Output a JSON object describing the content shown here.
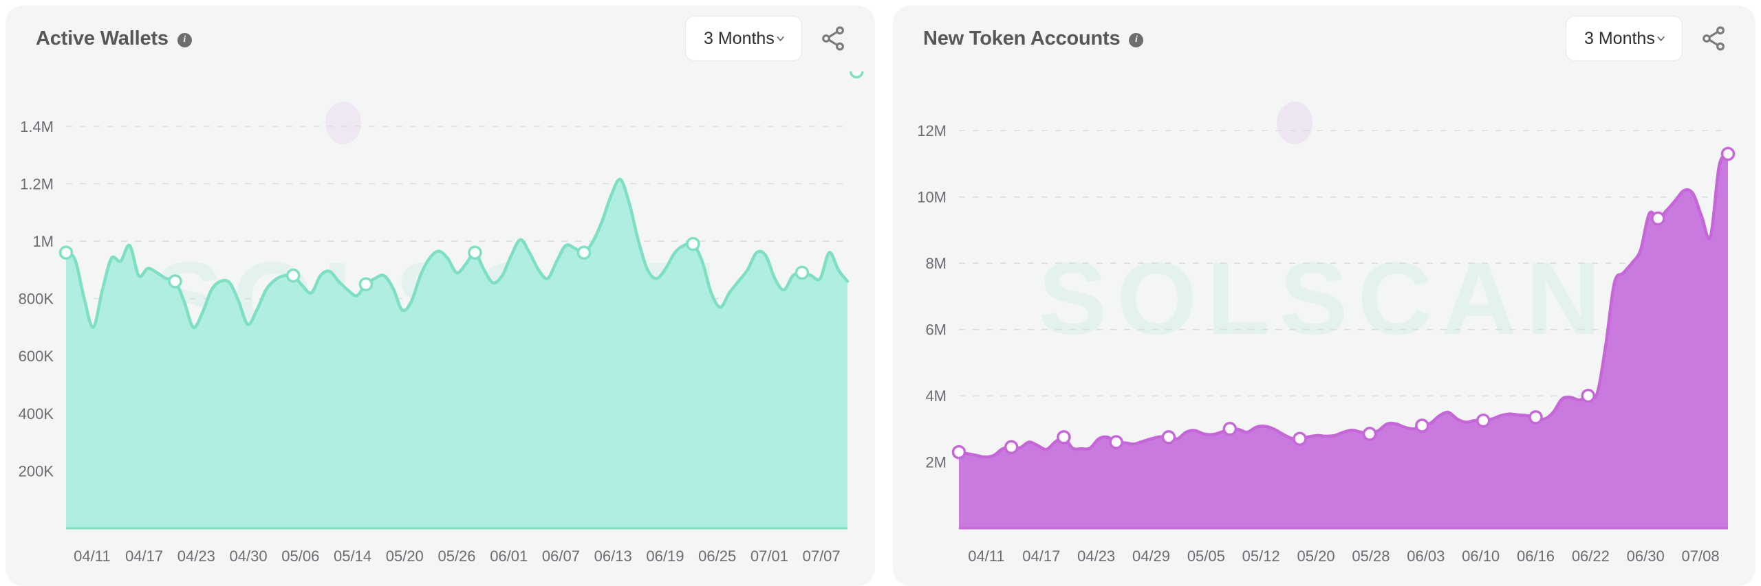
{
  "panels": [
    {
      "title": "Active Wallets",
      "info_icon": "info-icon",
      "range_label": "3 Months",
      "chevron_icon": "chevron-down-icon",
      "share_icon": "share-icon",
      "watermark": "SOLSCAN",
      "accent": "#7EE0C3",
      "fill": "#AFEEE0"
    },
    {
      "title": "New Token Accounts",
      "info_icon": "info-icon",
      "range_label": "3 Months",
      "chevron_icon": "chevron-down-icon",
      "share_icon": "share-icon",
      "watermark": "SOLSCAN",
      "accent": "#C765DA",
      "fill": "#C87ADF"
    }
  ],
  "chart_data": [
    {
      "type": "area",
      "title": "Active Wallets",
      "xlabel": "",
      "ylabel": "",
      "grid": true,
      "legend": null,
      "ylim": [
        0,
        1500000
      ],
      "yticks": [
        200000,
        400000,
        600000,
        800000,
        1000000,
        1200000,
        1400000
      ],
      "ytick_labels": [
        "200K",
        "400K",
        "600K",
        "800K",
        "1M",
        "1.2M",
        "1.4M"
      ],
      "xtick_labels": [
        "04/11",
        "04/17",
        "04/23",
        "04/30",
        "05/06",
        "05/14",
        "05/20",
        "05/26",
        "06/01",
        "06/07",
        "06/13",
        "06/19",
        "06/25",
        "07/01",
        "07/07"
      ],
      "marker_points": [
        {
          "x": "04/11",
          "y": 960000
        },
        {
          "x": "04/23",
          "y": 860000
        },
        {
          "x": "05/06",
          "y": 880000
        },
        {
          "x": "05/14",
          "y": 850000
        },
        {
          "x": "05/26",
          "y": 960000
        },
        {
          "x": "06/07",
          "y": 960000
        },
        {
          "x": "06/19",
          "y": 990000
        },
        {
          "x": "07/01",
          "y": 880000
        },
        {
          "x": "07/07",
          "y": 860000
        }
      ],
      "x": [
        "04/11",
        "04/12",
        "04/13",
        "04/14",
        "04/15",
        "04/16",
        "04/17",
        "04/18",
        "04/19",
        "04/20",
        "04/21",
        "04/22",
        "04/23",
        "04/24",
        "04/25",
        "04/26",
        "04/27",
        "04/28",
        "04/29",
        "04/30",
        "05/01",
        "05/02",
        "05/03",
        "05/04",
        "05/05",
        "05/06",
        "05/07",
        "05/08",
        "05/09",
        "05/10",
        "05/11",
        "05/12",
        "05/13",
        "05/14",
        "05/15",
        "05/16",
        "05/17",
        "05/18",
        "05/19",
        "05/20",
        "05/21",
        "05/22",
        "05/23",
        "05/24",
        "05/25",
        "05/26",
        "05/27",
        "05/28",
        "05/29",
        "05/30",
        "05/31",
        "06/01",
        "06/02",
        "06/03",
        "06/04",
        "06/05",
        "06/06",
        "06/07",
        "06/08",
        "06/09",
        "06/10",
        "06/11",
        "06/12",
        "06/13",
        "06/14",
        "06/15",
        "06/16",
        "06/17",
        "06/18",
        "06/19",
        "06/20",
        "06/21",
        "06/22",
        "06/23",
        "06/24",
        "06/25",
        "06/26",
        "06/27",
        "06/28",
        "06/29",
        "06/30",
        "07/01",
        "07/02",
        "07/03",
        "07/04",
        "07/05",
        "07/06",
        "07/07"
      ],
      "values": [
        960000,
        935000,
        800000,
        700000,
        830000,
        940000,
        930000,
        985000,
        880000,
        905000,
        890000,
        870000,
        860000,
        790000,
        700000,
        750000,
        830000,
        860000,
        855000,
        790000,
        710000,
        760000,
        830000,
        865000,
        880000,
        880000,
        845000,
        820000,
        880000,
        895000,
        860000,
        830000,
        810000,
        850000,
        870000,
        880000,
        835000,
        760000,
        790000,
        880000,
        940000,
        965000,
        940000,
        890000,
        920000,
        960000,
        900000,
        855000,
        880000,
        950000,
        1005000,
        960000,
        900000,
        870000,
        930000,
        985000,
        975000,
        960000,
        1000000,
        1070000,
        1160000,
        1215000,
        1130000,
        1000000,
        900000,
        870000,
        905000,
        960000,
        985000,
        990000,
        930000,
        820000,
        770000,
        820000,
        860000,
        900000,
        960000,
        950000,
        870000,
        830000,
        880000,
        890000,
        880000,
        870000,
        960000,
        900000,
        860000
      ]
    },
    {
      "type": "area",
      "title": "New Token Accounts",
      "xlabel": "",
      "ylabel": "",
      "grid": true,
      "legend": null,
      "ylim": [
        0,
        13000000
      ],
      "yticks": [
        2000000,
        4000000,
        6000000,
        8000000,
        10000000,
        12000000
      ],
      "ytick_labels": [
        "2M",
        "4M",
        "6M",
        "8M",
        "10M",
        "12M"
      ],
      "xtick_labels": [
        "04/11",
        "04/17",
        "04/23",
        "04/29",
        "05/05",
        "05/12",
        "05/20",
        "05/28",
        "06/03",
        "06/10",
        "06/16",
        "06/22",
        "06/30",
        "07/08"
      ],
      "marker_points": [
        {
          "x": "04/11",
          "y": 2300000
        },
        {
          "x": "04/17",
          "y": 2450000
        },
        {
          "x": "04/23",
          "y": 2750000
        },
        {
          "x": "04/29",
          "y": 2600000
        },
        {
          "x": "05/05",
          "y": 2750000
        },
        {
          "x": "05/12",
          "y": 3000000
        },
        {
          "x": "05/20",
          "y": 2700000
        },
        {
          "x": "05/28",
          "y": 2850000
        },
        {
          "x": "06/03",
          "y": 3100000
        },
        {
          "x": "06/10",
          "y": 3250000
        },
        {
          "x": "06/16",
          "y": 3350000
        },
        {
          "x": "06/22",
          "y": 4000000
        },
        {
          "x": "06/30",
          "y": 9350000
        },
        {
          "x": "07/08",
          "y": 10950000
        }
      ],
      "x": [
        "04/11",
        "04/12",
        "04/13",
        "04/14",
        "04/15",
        "04/16",
        "04/17",
        "04/18",
        "04/19",
        "04/20",
        "04/21",
        "04/22",
        "04/23",
        "04/24",
        "04/25",
        "04/26",
        "04/27",
        "04/28",
        "04/29",
        "04/30",
        "05/01",
        "05/02",
        "05/03",
        "05/04",
        "05/05",
        "05/06",
        "05/07",
        "05/08",
        "05/09",
        "05/10",
        "05/11",
        "05/12",
        "05/13",
        "05/14",
        "05/15",
        "05/16",
        "05/17",
        "05/18",
        "05/19",
        "05/20",
        "05/21",
        "05/22",
        "05/23",
        "05/24",
        "05/25",
        "05/26",
        "05/27",
        "05/28",
        "05/29",
        "05/30",
        "05/31",
        "06/01",
        "06/02",
        "06/03",
        "06/04",
        "06/05",
        "06/06",
        "06/07",
        "06/08",
        "06/09",
        "06/10",
        "06/11",
        "06/12",
        "06/13",
        "06/14",
        "06/15",
        "06/16",
        "06/17",
        "06/18",
        "06/19",
        "06/20",
        "06/21",
        "06/22",
        "06/23",
        "06/24",
        "06/25",
        "06/26",
        "06/27",
        "06/28",
        "06/29",
        "06/30",
        "07/01",
        "07/02",
        "07/03",
        "07/04",
        "07/05",
        "07/06",
        "07/07",
        "07/08"
      ],
      "values": [
        2300000,
        2250000,
        2200000,
        2150000,
        2200000,
        2400000,
        2450000,
        2430000,
        2600000,
        2500000,
        2380000,
        2600000,
        2750000,
        2420000,
        2400000,
        2420000,
        2700000,
        2750000,
        2600000,
        2580000,
        2540000,
        2620000,
        2700000,
        2760000,
        2750000,
        2700000,
        2900000,
        2950000,
        2850000,
        2830000,
        2900000,
        3000000,
        2980000,
        2900000,
        3050000,
        3080000,
        3000000,
        2850000,
        2720000,
        2700000,
        2760000,
        2800000,
        2780000,
        2800000,
        2900000,
        2960000,
        2900000,
        2850000,
        2950000,
        3150000,
        3150000,
        3050000,
        3000000,
        3100000,
        3180000,
        3400000,
        3500000,
        3300000,
        3200000,
        3250000,
        3250000,
        3300000,
        3400000,
        3450000,
        3420000,
        3400000,
        3350000,
        3300000,
        3500000,
        3900000,
        3950000,
        3870000,
        4000000,
        4050000,
        5500000,
        7400000,
        7700000,
        8000000,
        8400000,
        9500000,
        9350000,
        9600000,
        9900000,
        10200000,
        10100000,
        9400000,
        8800000,
        10950000,
        11300000
      ]
    }
  ]
}
